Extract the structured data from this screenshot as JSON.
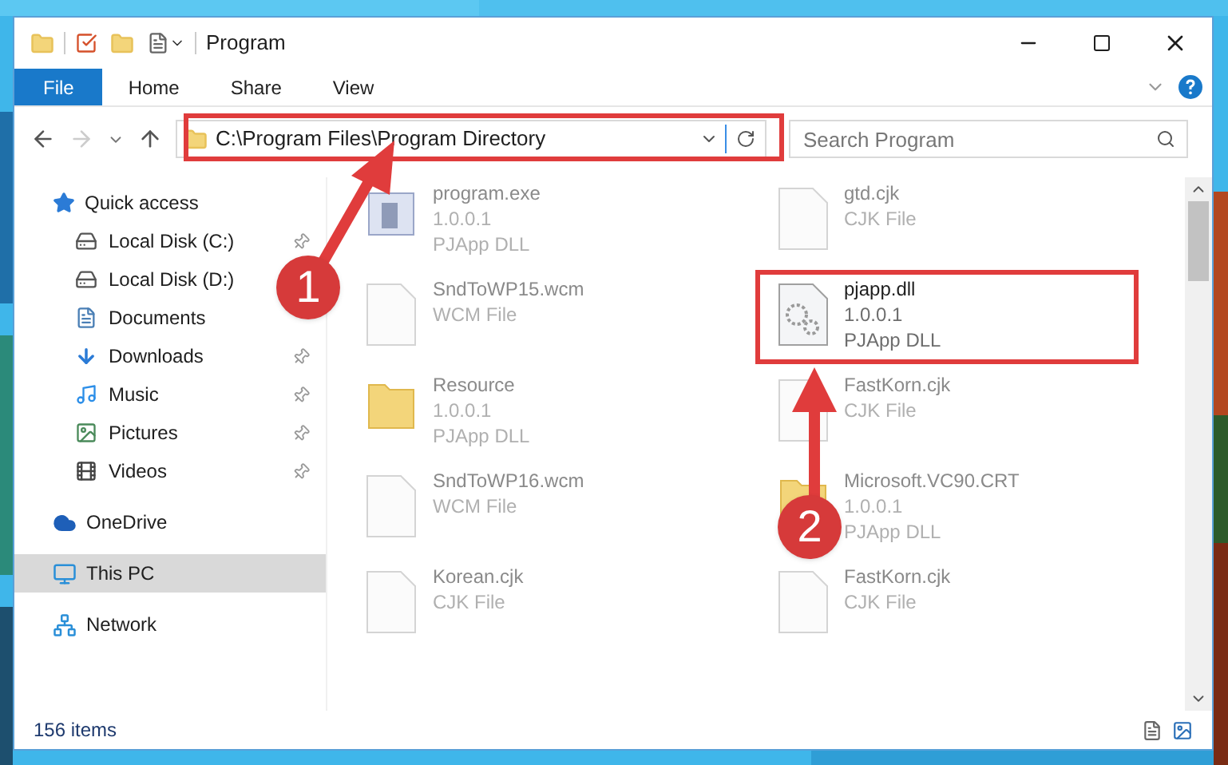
{
  "window": {
    "title": "Program"
  },
  "ribbon": {
    "tabs": [
      {
        "label": "File",
        "selected": true
      },
      {
        "label": "Home",
        "selected": false
      },
      {
        "label": "Share",
        "selected": false
      },
      {
        "label": "View",
        "selected": false
      }
    ]
  },
  "address_bar": {
    "path": "C:\\Program Files\\Program Directory"
  },
  "search": {
    "placeholder": "Search Program"
  },
  "sidebar": {
    "items": [
      {
        "label": "Quick access",
        "kind": "star",
        "selected": false,
        "children": [
          {
            "label": "Local Disk (C:)",
            "kind": "disk",
            "pinned": true
          },
          {
            "label": "Local Disk (D:)",
            "kind": "disk",
            "pinned": false
          },
          {
            "label": "Documents",
            "kind": "documents",
            "pinned": false
          },
          {
            "label": "Downloads",
            "kind": "downloads",
            "pinned": true
          },
          {
            "label": "Music",
            "kind": "music",
            "pinned": true
          },
          {
            "label": "Pictures",
            "kind": "pictures",
            "pinned": true
          },
          {
            "label": "Videos",
            "kind": "videos",
            "pinned": true
          }
        ]
      },
      {
        "label": "OneDrive",
        "kind": "cloud",
        "selected": false
      },
      {
        "label": "This PC",
        "kind": "pc",
        "selected": true
      },
      {
        "label": "Network",
        "kind": "network",
        "selected": false
      }
    ]
  },
  "files": [
    {
      "name": "program.exe",
      "details": [
        "1.0.0.1",
        "PJApp DLL"
      ],
      "kind": "exe",
      "blurred": true
    },
    {
      "name": "gtd.cjk",
      "details": [
        "CJK File"
      ],
      "kind": "file",
      "blurred": true
    },
    {
      "name": "SndToWP15.wcm",
      "details": [
        "WCM File"
      ],
      "kind": "file",
      "blurred": true
    },
    {
      "name": "pjapp.dll",
      "details": [
        "1.0.0.1",
        "PJApp DLL"
      ],
      "kind": "dll",
      "blurred": false
    },
    {
      "name": "Resource",
      "details": [
        "1.0.0.1",
        "PJApp DLL"
      ],
      "kind": "folder",
      "blurred": true
    },
    {
      "name": "FastKorn.cjk",
      "details": [
        "CJK File"
      ],
      "kind": "file",
      "blurred": true
    },
    {
      "name": "SndToWP16.wcm",
      "details": [
        "WCM File"
      ],
      "kind": "file",
      "blurred": true
    },
    {
      "name": "Microsoft.VC90.CRT",
      "details": [
        "1.0.0.1",
        "PJApp DLL"
      ],
      "kind": "folder",
      "blurred": true
    },
    {
      "name": "Korean.cjk",
      "details": [
        "CJK File"
      ],
      "kind": "file",
      "blurred": true
    },
    {
      "name": "FastKorn.cjk",
      "details": [
        "CJK File"
      ],
      "kind": "file",
      "blurred": true
    }
  ],
  "status_bar": {
    "count": "156 items"
  },
  "annotations": [
    {
      "label": "1"
    },
    {
      "label": "2"
    }
  ]
}
